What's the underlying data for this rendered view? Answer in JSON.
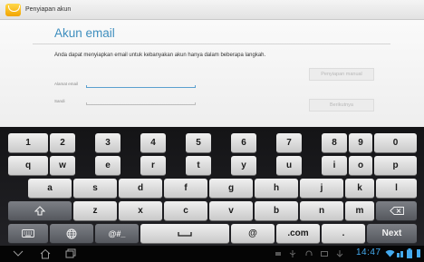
{
  "titlebar": {
    "title": "Penyiapan akun"
  },
  "form": {
    "heading": "Akun email",
    "description": "Anda dapat menyiapkan email untuk kebanyakan akun hanya dalam beberapa langkah.",
    "email_label": "Alamat email",
    "password_label": "Sandi",
    "email_value": "",
    "password_value": "",
    "manual_button": "Penyiapan manual",
    "next_button": "Berikutnya"
  },
  "keyboard": {
    "row1": [
      "1",
      "2",
      "3",
      "4",
      "5",
      "6",
      "7",
      "8",
      "9",
      "0"
    ],
    "row2": [
      "q",
      "w",
      "e",
      "r",
      "t",
      "y",
      "u",
      "i",
      "o",
      "p"
    ],
    "row3": [
      "a",
      "s",
      "d",
      "f",
      "g",
      "h",
      "j",
      "k",
      "l"
    ],
    "row4": [
      "z",
      "x",
      "c",
      "v",
      "b",
      "n",
      "m"
    ],
    "symbols_label": "@#_",
    "at_label": "@",
    "com_label": ".com",
    "dot_label": ".",
    "next_label": "Next"
  },
  "statusbar": {
    "time": "14:47"
  },
  "colors": {
    "accent": "#3e8ebe",
    "clock": "#44aaee",
    "keyboard_bg": "#1a1a1c"
  }
}
